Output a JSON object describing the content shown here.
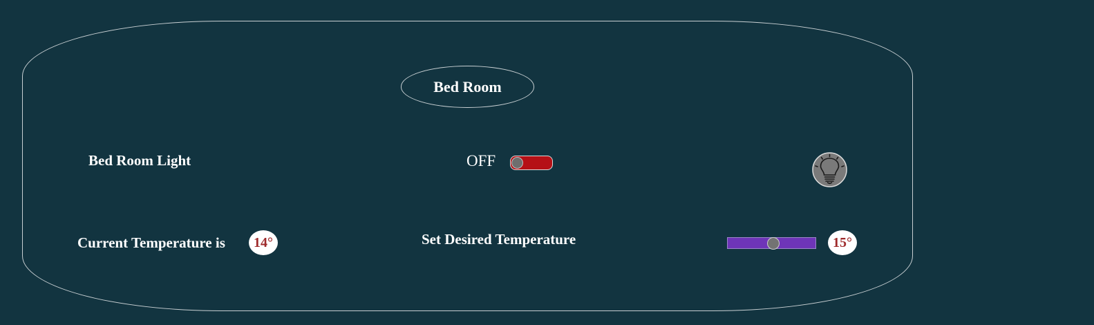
{
  "room": {
    "title": "Bed Room"
  },
  "light": {
    "label": "Bed Room Light",
    "state_text": "OFF",
    "toggle_color": "#b51016",
    "icon": "lightbulb-icon"
  },
  "temperature": {
    "current_label": "Current Temperature is",
    "current_value": "14°",
    "desired_label": "Set Desired Temperature",
    "desired_value": "15°",
    "slider_position": 0.52,
    "slider_color": "#6e35b8",
    "value_color": "#9e2a2b"
  },
  "colors": {
    "background": "#123440",
    "border": "#c9d0d3"
  }
}
